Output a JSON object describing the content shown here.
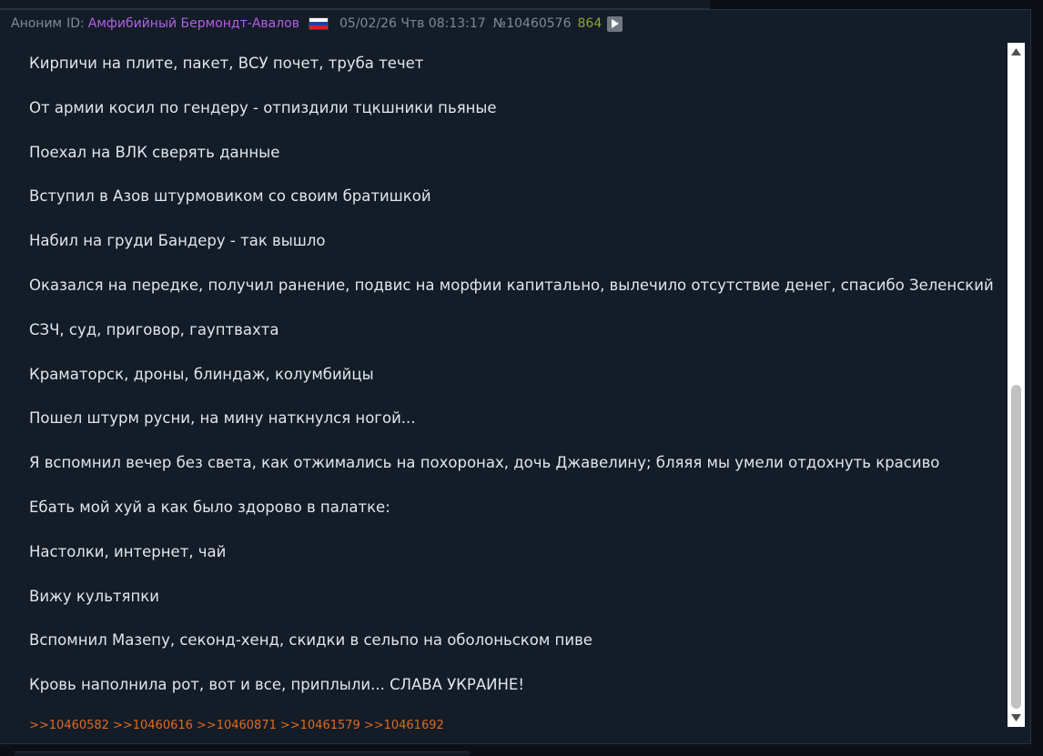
{
  "header": {
    "anon_label": "Аноним",
    "id_label": "ID:",
    "id_name": "Амфибийный Бермондт-Авалов",
    "flag_icon": "russia-flag-icon",
    "date": "05/02/26 Чтв 08:13:17",
    "post_number": "№10460576",
    "post_count": "864",
    "play_icon": "play-icon"
  },
  "post_lines": [
    "Кирпичи на плите, пакет, ВСУ почет, труба течет",
    "От армии косил по гендеру - отпиздили тцкшники пьяные",
    "Поехал на ВЛК сверять данные",
    "Вступил в Азов штурмовиком со своим братишкой",
    "Набил на груди Бандеру - так вышло",
    "Оказался на передке, получил ранение, подвис на морфии капитально, вылечило отсутствие денег, спасибо Зеленский",
    "СЗЧ, суд, приговор, гауптвахта",
    "Краматорск, дроны, блиндаж, колумбийцы",
    "Пошел штурм русни, на мину наткнулся ногой...",
    "Я вспомнил вечер без света, как отжимались на похоронах, дочь Джавелину; бляяя мы умели отдохнуть красиво",
    "Ебать мой хуй а как было здорово в палатке:",
    "Настолки, интернет, чай",
    "Вижу культяпки",
    "Вспомнил Мазепу, секонд-хенд, скидки в сельпо на оболоньском пиве",
    "Кровь наполнила рот, вот и все, приплыли... СЛАВА УКРАИНЕ!"
  ],
  "replies": [
    ">>10460582",
    ">>10460616",
    ">>10460871",
    ">>10461579",
    ">>10461692"
  ],
  "scrollbar": {
    "position_fraction": 0.5,
    "visible_fraction": 0.5
  },
  "colors": {
    "background": "#131c27",
    "text": "#e1e6ec",
    "id_name": "#b45ee8",
    "post_count": "#8ea42c",
    "reply_link": "#e06a1f",
    "meta": "#7f8a96"
  }
}
